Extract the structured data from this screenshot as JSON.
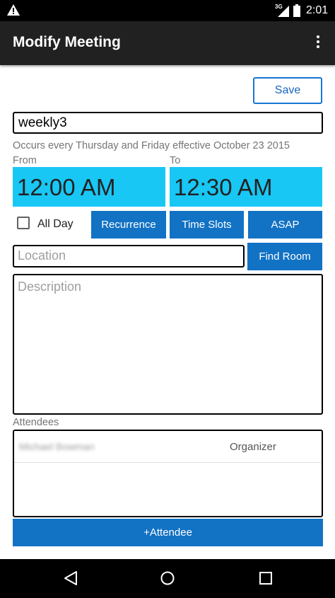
{
  "status_bar": {
    "network": "3G",
    "time": "2:01",
    "warning_icon": "warning-triangle-icon"
  },
  "app_bar": {
    "title": "Modify Meeting",
    "menu_icon": "overflow-menu-icon"
  },
  "toolbar": {
    "save_label": "Save"
  },
  "meeting": {
    "title_value": "weekly3",
    "recurrence_text": "Occurs every Thursday and Friday effective October 23 2015",
    "from_label": "From",
    "to_label": "To",
    "from_time": "12:00 AM",
    "to_time": "12:30 AM",
    "all_day_label": "All Day",
    "all_day_checked": false,
    "location_placeholder": "Location",
    "description_placeholder": "Description"
  },
  "buttons": {
    "recurrence": "Recurrence",
    "time_slots": "Time Slots",
    "asap": "ASAP",
    "find_room": "Find Room",
    "add_attendee": "+Attendee"
  },
  "attendees": {
    "label": "Attendees",
    "list": [
      {
        "name": "Michael Bowman",
        "role": "Organizer"
      }
    ]
  },
  "colors": {
    "accent": "#1272c4",
    "time_bg": "#18c7f4",
    "appbar": "#212121"
  }
}
